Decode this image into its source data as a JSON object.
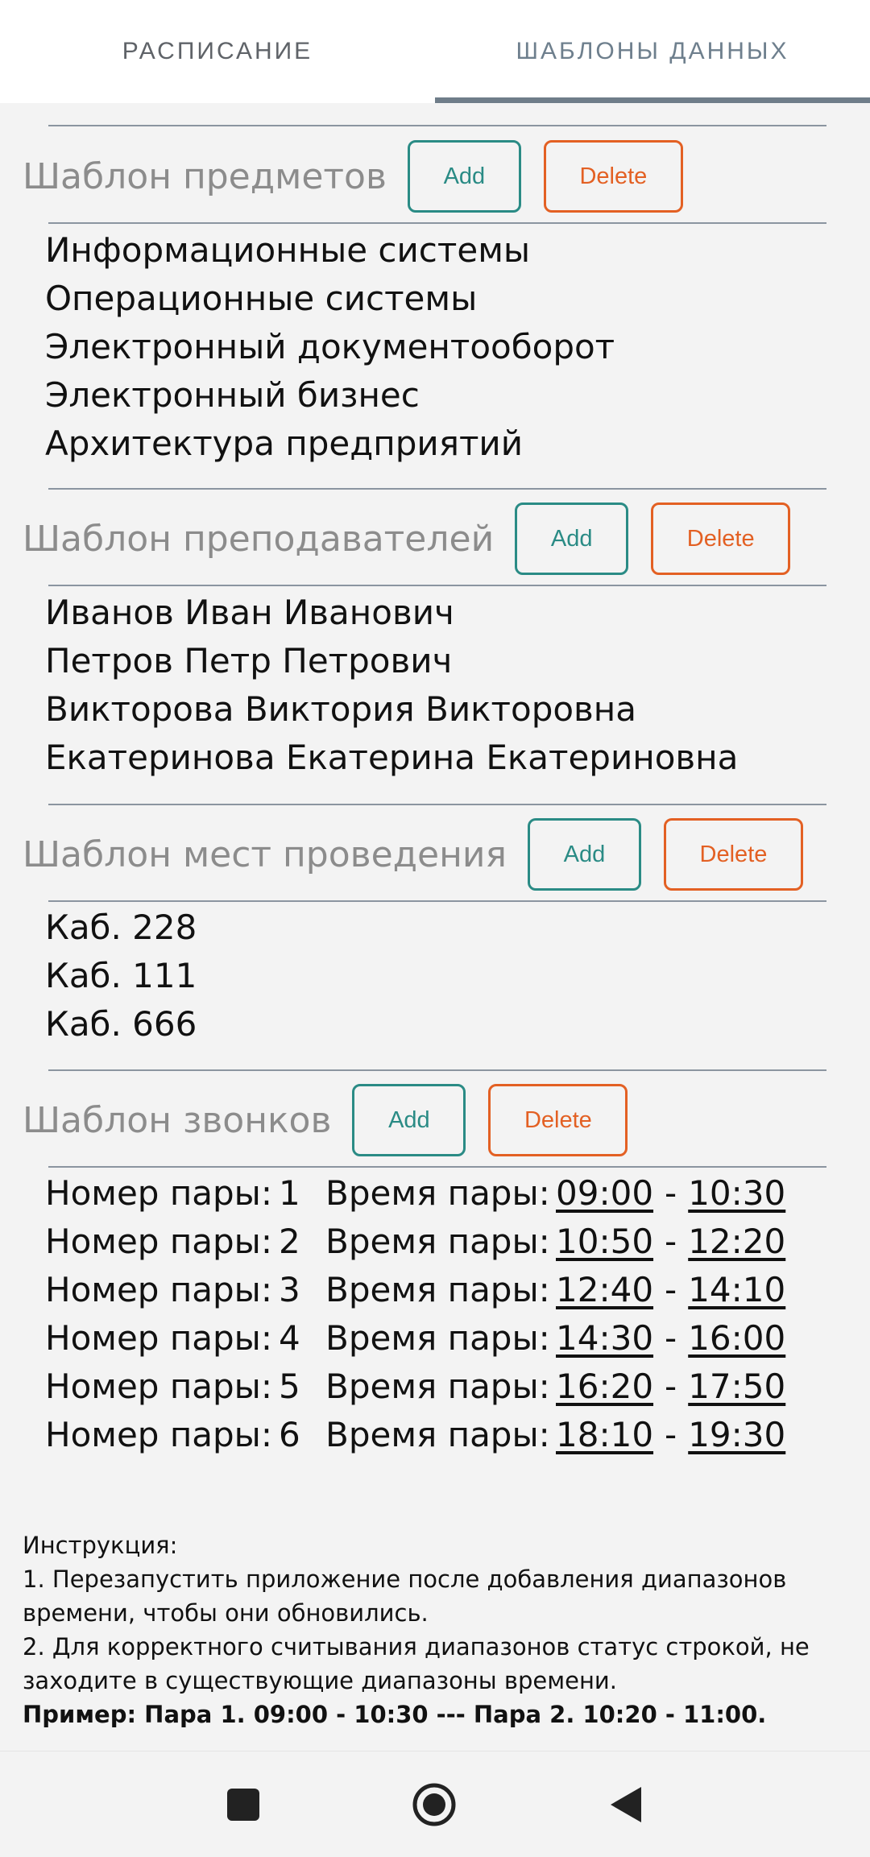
{
  "tabs": [
    {
      "label": "РАСПИСАНИЕ"
    },
    {
      "label": "ШАБЛОНЫ ДАННЫХ"
    }
  ],
  "buttons": {
    "add": "Add",
    "delete": "Delete"
  },
  "subjects": {
    "title": "Шаблон предметов",
    "items": [
      "Информационные системы",
      "Операционные системы",
      "Электронный документооборот",
      "Электронный бизнес",
      "Архитектура предприятий"
    ]
  },
  "teachers": {
    "title": "Шаблон преподавателей",
    "items": [
      "Иванов Иван Иванович",
      "Петров Петр Петрович",
      "Викторова Виктория Викторовна",
      "Екатеринова Екатерина Екатериновна"
    ]
  },
  "places": {
    "title": "Шаблон мест проведения",
    "items": [
      "Каб. 228",
      "Каб. 111",
      "Каб. 666"
    ]
  },
  "bells": {
    "title": "Шаблон звонков",
    "pair_label": "Номер пары:",
    "time_label": "Время пары:",
    "rows": [
      {
        "num": "1",
        "start": "09:00",
        "end": "10:30"
      },
      {
        "num": "2",
        "start": "10:50",
        "end": "12:20"
      },
      {
        "num": "3",
        "start": "12:40",
        "end": "14:10"
      },
      {
        "num": "4",
        "start": "14:30",
        "end": "16:00"
      },
      {
        "num": "5",
        "start": "16:20",
        "end": "17:50"
      },
      {
        "num": "6",
        "start": "18:10",
        "end": "19:30"
      }
    ]
  },
  "instructions": {
    "heading": "Инструкция:",
    "line1": "1. Перезапустить приложение после добавления диапазонов времени, чтобы они обновились.",
    "line2": "2. Для корректного считывания диапазонов статус строкой, не заходите в существующие диапазоны времени.",
    "example": "Пример: Пара 1. 09:00 - 10:30 --- Пара 2. 10:20 - 11:00."
  },
  "colors": {
    "add": "#2a8b85",
    "delete": "#e36023",
    "tab_indicator": "#6f7d89",
    "section_title": "#8c8c8c"
  },
  "navbar": {
    "icons": [
      "recents-icon",
      "home-icon",
      "back-icon"
    ]
  }
}
